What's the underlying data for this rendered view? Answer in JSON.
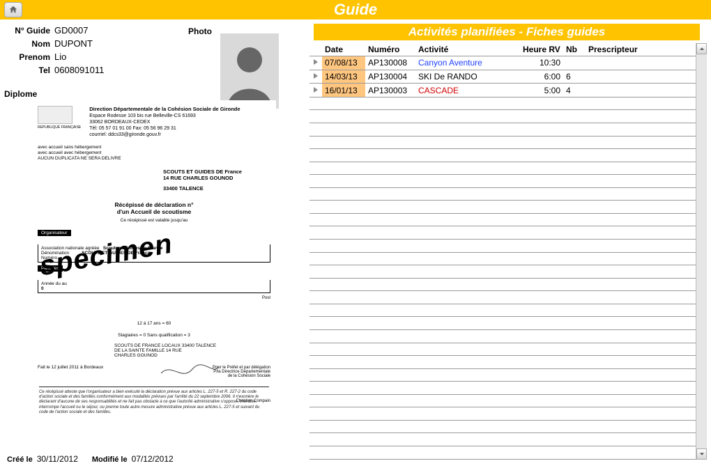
{
  "header": {
    "title": "Guide"
  },
  "guide": {
    "num_label": "N° Guide",
    "num_value": "GD0007",
    "nom_label": "Nom",
    "nom_value": "DUPONT",
    "prenom_label": "Prenom",
    "prenom_value": "Lio",
    "tel_label": "Tel",
    "tel_value": "0608091011",
    "photo_label": "Photo",
    "diplome_label": "Diplome"
  },
  "doc": {
    "direction": "Direction Départementale de la Cohésion Sociale de Gironde",
    "espace1": "Espace Rodesse 103 bis rue Belleville-CS 61693",
    "espace2": "33062 BORDEAUX-CEDEX",
    "espace3": "Tél: 05 57 01 91 00  Fax: 05 56 96 29 31",
    "espace4": "courriel: ddcs33@gironde.gouv.fr",
    "accueil1": "avec accueil sans hébergement",
    "accueil2": "avec accueil avec hébergement",
    "aucun": "AUCUN DUPLICATA NE SERA DELIVRE",
    "scouts1": "SCOUTS ET GUIDES DE France",
    "scouts2": "14 RUE CHARLES GOUNOD",
    "scouts3": "33400 TALENCE",
    "rec1": "Récépissé de déclaration n°",
    "rec2": "d'un Accueil de scoutisme",
    "rec3": "Ce récépissé est valable jusqu'au",
    "org_tab": "Organisateur",
    "org1": "Association nationale agréée",
    "org2": "Scouts et Guides de France",
    "org3": "Dénomination",
    "org4": "SCOUTS ET GUIDES DE France",
    "org5": "Numéro",
    "per_tab": "Périodes",
    "per1": "Année   du   au",
    "per2": "0",
    "mid1": "12 à 17 ans = 60",
    "mid2": "Stagiaires = 0      Sans qualification = 3",
    "addr1": "SCOUTS DE FRANCE LOCAUX 33400   TALENCE",
    "addr2": "DE LA SAINTE FAMILLE  14 RUE",
    "addr3": "CHARLES GOUNOD",
    "fait": "Fait le 12 juillet 2011 à Bordeaux",
    "sign1": "Pour le Préfet et par délégation",
    "sign2": "P/la Directrice Départementale",
    "sign3": "de la Cohésion Sociale",
    "sign4": "Christian Compain",
    "foot": "Ce récépissé atteste que l'organisateur a bien exécuté la déclaration prévue aux articles L. 227-5 et R. 227-2 du code d'action sociale et des familles conformément aux modalités prévues par l'arrêté du 22 septembre 2006. Il n'exonère le déclarant d'aucune de ses responsabilités et ne fait pas obstacle à ce que l'autorité administrative s'oppose, interdise, interrompe l'accueil ou le séjour, ou prenne toute autre mesure administrative prévue aux articles L. 227-5 et suivant du code de l'action sociale et des familles.",
    "specimen": "specimen",
    "post": "Post"
  },
  "dates": {
    "created_label": "Créé le",
    "created_value": "30/11/2012",
    "modified_label": "Modifié le",
    "modified_value": "07/12/2012"
  },
  "activities": {
    "panel_title": "Activités planifiées - Fiches guides",
    "columns": {
      "date": "Date",
      "numero": "Numéro",
      "activite": "Activité",
      "heure": "Heure RV",
      "nb": "Nb",
      "prescripteur": "Prescripteur"
    },
    "rows": [
      {
        "date": "07/08/13",
        "numero": "AP130008",
        "activite": "Canyon Aventure",
        "activite_class": "act-blue",
        "heure": "10:30",
        "nb": "",
        "prescripteur": ""
      },
      {
        "date": "14/03/13",
        "numero": "AP130004",
        "activite": "SKI De RANDO",
        "activite_class": "",
        "heure": "6:00",
        "nb": "6",
        "prescripteur": ""
      },
      {
        "date": "16/01/13",
        "numero": "AP130003",
        "activite": "CASCADE",
        "activite_class": "act-red",
        "heure": "5:00",
        "nb": "4",
        "prescripteur": ""
      }
    ],
    "empty_rows": 28
  }
}
